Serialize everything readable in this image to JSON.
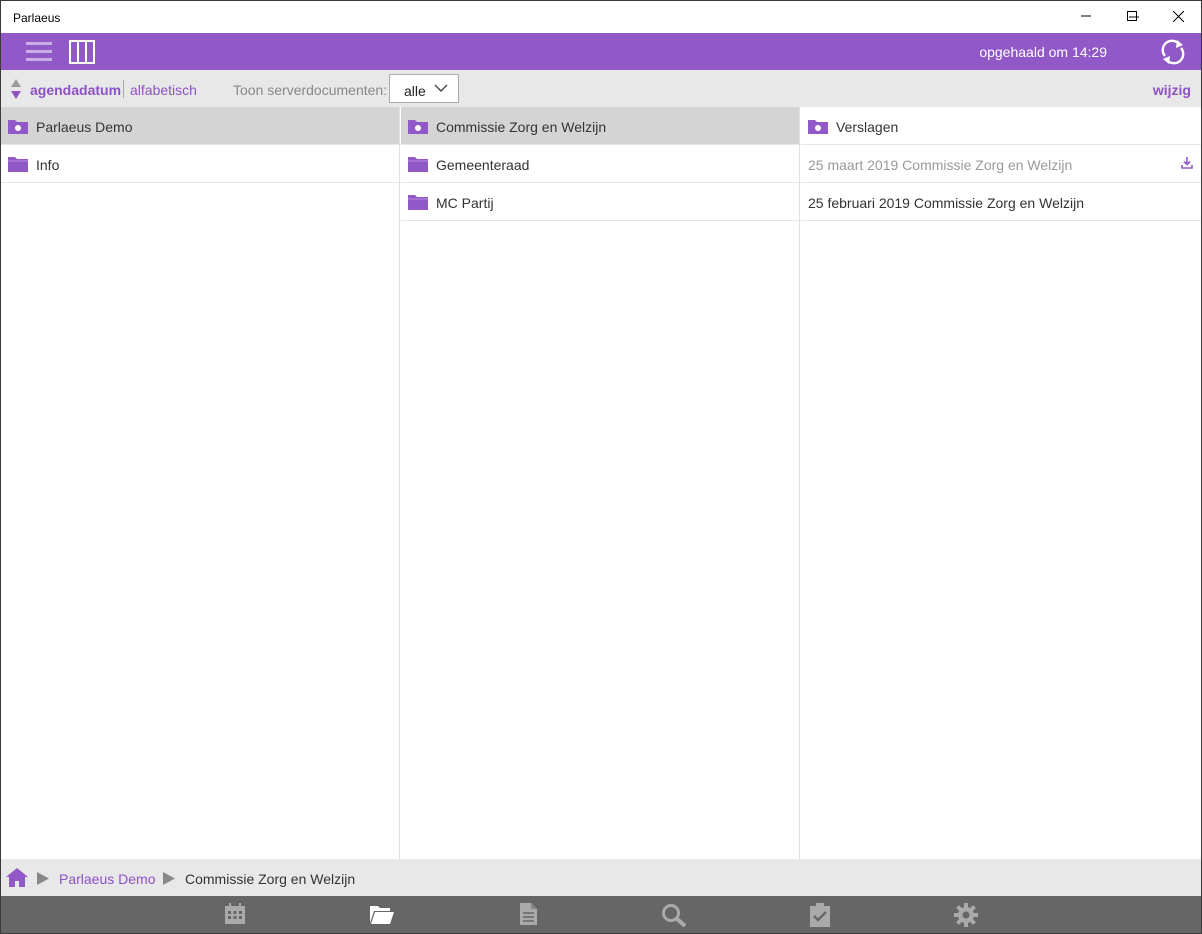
{
  "window": {
    "title": "Parlaeus"
  },
  "header": {
    "sync_status": "opgehaald om 14:29"
  },
  "toolbar": {
    "sort_active": "agendadatum",
    "sort_other": "alfabetisch",
    "filter_label": "Toon serverdocumenten:",
    "filter_value": "alle",
    "edit_label": "wijzig"
  },
  "columns": {
    "col1": [
      {
        "label": "Parlaeus Demo",
        "icon": "folder-special-icon",
        "selected": true
      },
      {
        "label": "Info",
        "icon": "folder-icon",
        "selected": false
      }
    ],
    "col2": [
      {
        "label": "Commissie Zorg en Welzijn",
        "icon": "folder-special-icon",
        "selected": true
      },
      {
        "label": "Gemeenteraad",
        "icon": "folder-icon",
        "selected": false
      },
      {
        "label": "MC Partij",
        "icon": "folder-icon",
        "selected": false
      }
    ],
    "col3": [
      {
        "label": "Verslagen",
        "icon": "folder-special-icon"
      },
      {
        "label": "25 maart 2019 Commissie Zorg en Welzijn",
        "state": "not-downloaded",
        "icon": "download-icon"
      },
      {
        "label": "25 februari 2019 Commissie Zorg en Welzijn",
        "state": "downloaded"
      }
    ]
  },
  "breadcrumb": {
    "items": [
      "Parlaeus Demo",
      "Commissie Zorg en Welzijn"
    ]
  },
  "bottom_nav": {
    "items": [
      "calendar-icon",
      "folder-open-icon",
      "document-icon",
      "search-icon",
      "clipboard-check-icon",
      "settings-gear-icon"
    ],
    "active": "folder-open-icon"
  },
  "colors": {
    "accent": "#9159c8",
    "link": "#8e52c4",
    "toolbar_bg": "#e8e8e8",
    "nav_bg": "#666666",
    "selected_row": "#d4d4d4"
  }
}
